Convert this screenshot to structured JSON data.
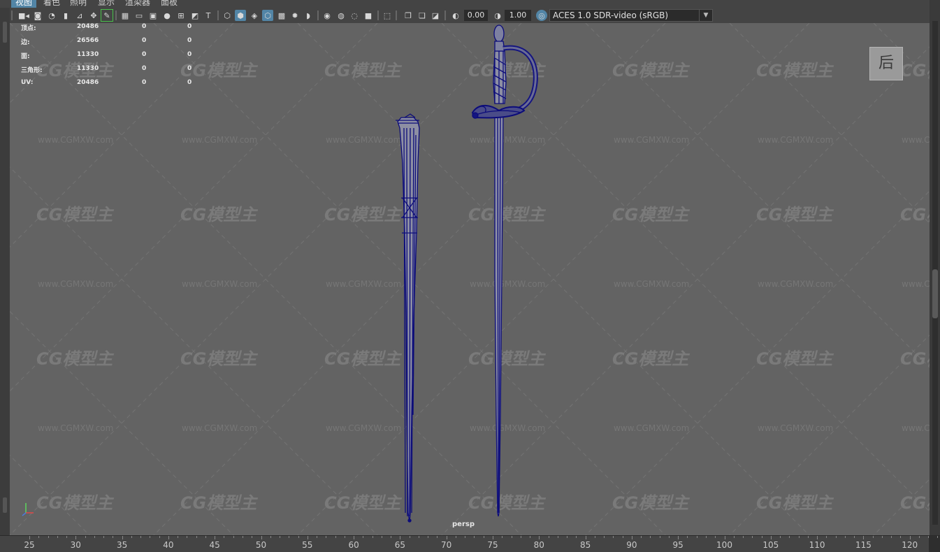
{
  "menubar": {
    "items": [
      "视图",
      "着色",
      "照明",
      "显示",
      "渲染器",
      "面板"
    ]
  },
  "toolbar": {
    "exposure_value": "0.00",
    "gamma_value": "1.00",
    "color_space": "ACES 1.0 SDR-video (sRGB)"
  },
  "hud": {
    "rows": [
      {
        "label": "顶点:",
        "total": "20486",
        "selected": "0",
        "components": "0"
      },
      {
        "label": "边:",
        "total": "26566",
        "selected": "0",
        "components": "0"
      },
      {
        "label": "面:",
        "total": "11330",
        "selected": "0",
        "components": "0"
      },
      {
        "label": "三角形:",
        "total": "11330",
        "selected": "0",
        "components": "0"
      },
      {
        "label": "UV:",
        "total": "20486",
        "selected": "0",
        "components": "0"
      }
    ]
  },
  "viewport": {
    "camera_name": "persp",
    "view_cube_label": "后",
    "watermark_text": "CG模型主",
    "watermark_url": "www.CGMXW.com",
    "wireframe_color": "#0c0c7a",
    "background_color": "#636363"
  },
  "timeline": {
    "frames": [
      "25",
      "30",
      "35",
      "40",
      "45",
      "50",
      "55",
      "60",
      "65",
      "70",
      "75",
      "80",
      "85",
      "90",
      "95",
      "100",
      "105",
      "110",
      "115",
      "120"
    ]
  },
  "colors": {
    "accent": "#5285a6",
    "panel": "#444444",
    "field": "#2b2b2b"
  }
}
